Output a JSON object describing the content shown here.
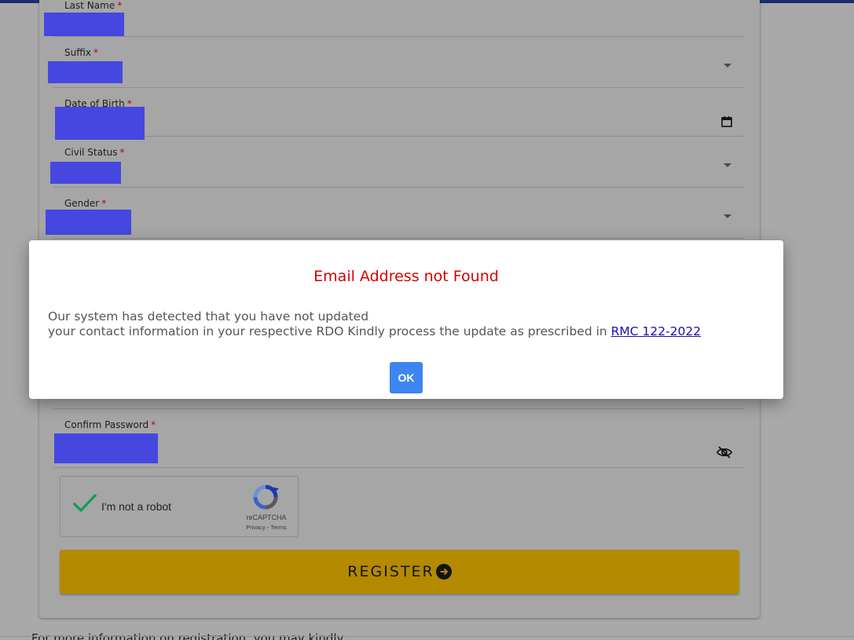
{
  "form": {
    "last_name_label": "Last Name",
    "suffix_label": "Suffix",
    "dob_label": "Date of Birth",
    "civil_status_label": "Civil Status",
    "gender_label": "Gender",
    "confirm_password_label": "Confirm Password",
    "required_marker": "*",
    "register_label": "REGISTER"
  },
  "captcha": {
    "label": "I'm not a robot",
    "brand": "reCAPTCHA",
    "privacy": "Privacy",
    "separator": " - ",
    "terms": "Terms"
  },
  "dialog": {
    "title": "Email Address not Found",
    "line1": "Our system has detected that you have not updated",
    "line2": "your contact information in your respective RDO Kindly process the update as prescribed in ",
    "link": "RMC 122-2022",
    "ok_label": "OK"
  },
  "footer": {
    "text": "For more information on registration, you may kindly"
  },
  "colors": {
    "register": "#b38a00",
    "redaction": "#4547e0",
    "dialog_title": "#d40000",
    "ok_button": "#3d86f0",
    "required": "#b00020",
    "captcha_check": "#0f9d58"
  },
  "icons": {
    "dob": "calendar-icon",
    "password_visibility": "eye-off-icon",
    "register": "arrow-right-circle-icon",
    "dropdown": "caret-down-icon",
    "captcha_check": "checkmark-icon",
    "captcha_logo": "recaptcha-logo-icon"
  }
}
